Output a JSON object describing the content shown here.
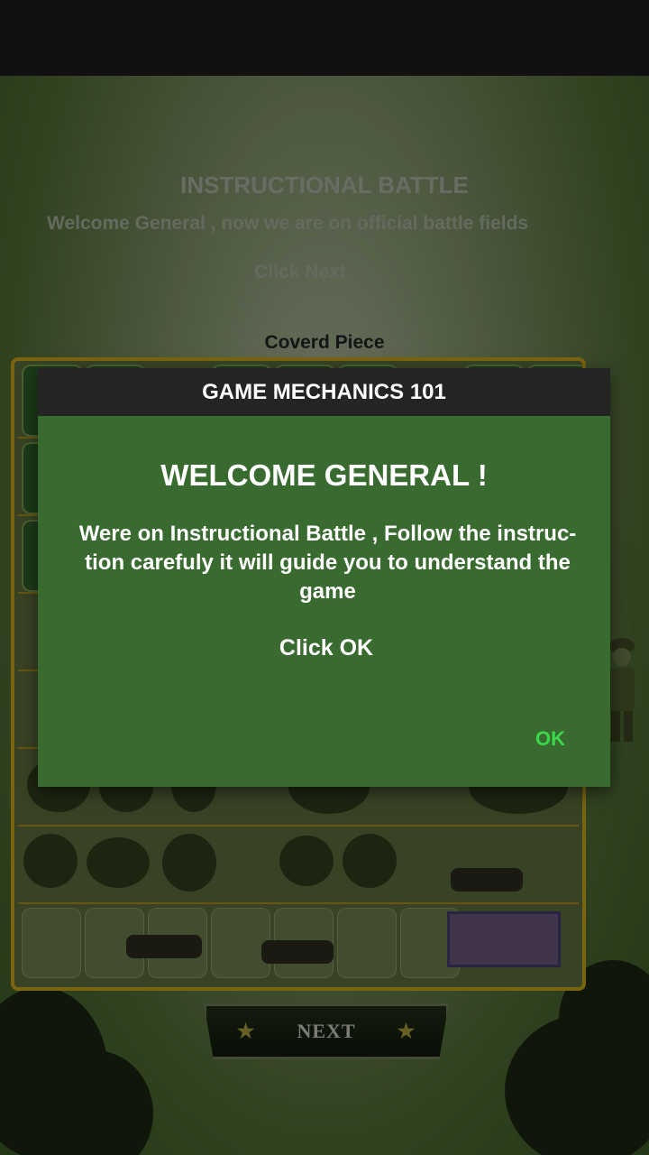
{
  "screen": {
    "title": "INSTRUCTIONAL BATTLE",
    "subtitle": "Welcome General , now we are on official battle fields",
    "instruction": "Click Next",
    "covered_label": "Coverd Piece",
    "next_button_label": "NEXT"
  },
  "dialog": {
    "header": "GAME MECHANICS 101",
    "heading": "WELCOME GENERAL !",
    "body": "Were on Instructional Battle , Follow the instruc-tion carefuly it will guide you to understand the game",
    "click_hint": "Click OK",
    "ok_label": "OK"
  },
  "colors": {
    "dialog_bg": "#396a2f",
    "dialog_header_bg": "#242424",
    "ok_text": "#38d84a",
    "board_border": "#c7a21a"
  }
}
